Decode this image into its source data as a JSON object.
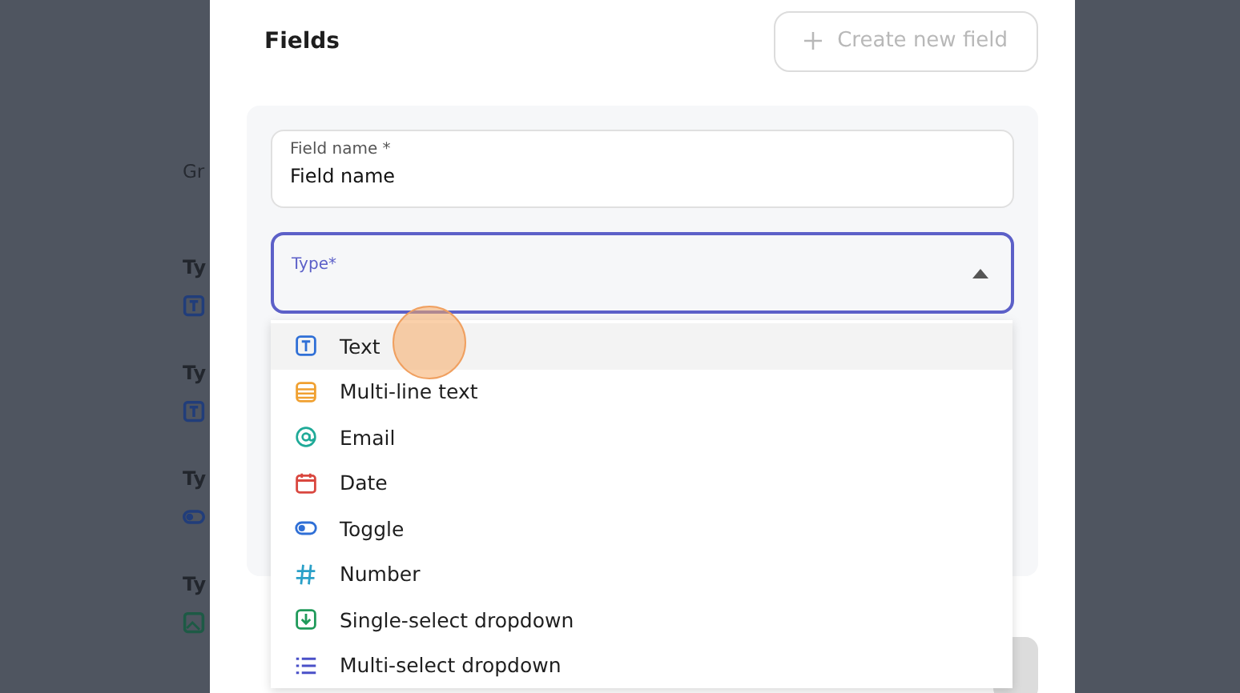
{
  "background": {
    "group_label": "Gr",
    "items": [
      {
        "label": "Ty",
        "kind": "text"
      },
      {
        "label": "Ty",
        "kind": "text"
      },
      {
        "label": "Ty",
        "kind": "toggle"
      },
      {
        "label": "Ty",
        "kind": "image"
      }
    ]
  },
  "modal": {
    "title": "Fields",
    "create_button": {
      "label": "Create new field",
      "disabled": true
    },
    "field_name": {
      "label": "Field name *",
      "value": "Field name"
    },
    "type_select": {
      "label": "Type*",
      "expanded": true
    },
    "options": [
      {
        "label": "Text",
        "kind": "text",
        "selected": true
      },
      {
        "label": "Multi-line text",
        "kind": "multiline",
        "selected": false
      },
      {
        "label": "Email",
        "kind": "email",
        "selected": false
      },
      {
        "label": "Date",
        "kind": "date",
        "selected": false
      },
      {
        "label": "Toggle",
        "kind": "toggle",
        "selected": false
      },
      {
        "label": "Number",
        "kind": "number",
        "selected": false
      },
      {
        "label": "Single-select dropdown",
        "kind": "single",
        "selected": false
      },
      {
        "label": "Multi-select dropdown",
        "kind": "multi",
        "selected": false
      }
    ]
  }
}
